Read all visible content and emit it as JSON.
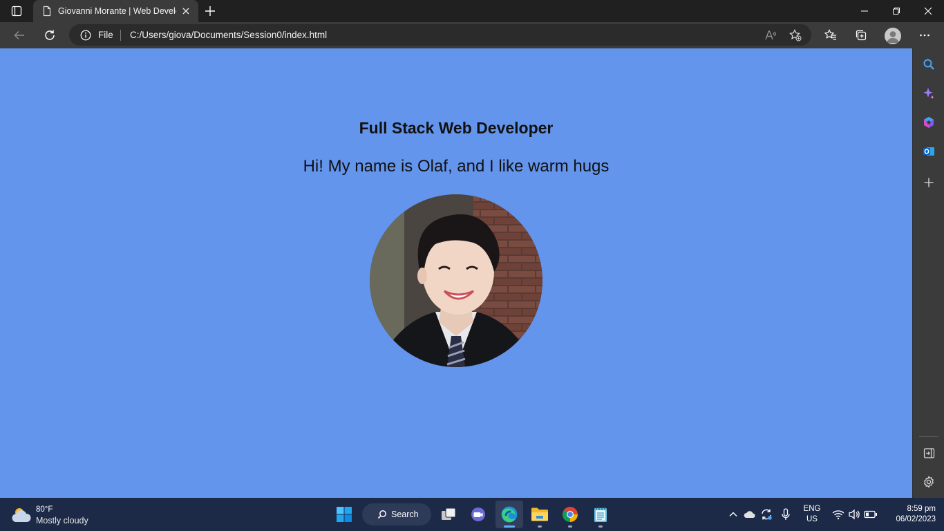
{
  "browser": {
    "tab": {
      "title": "Giovanni Morante | Web Developer"
    },
    "address": {
      "scheme_label": "File",
      "url": "C:/Users/giova/Documents/Session0/index.html"
    }
  },
  "page": {
    "heading": "Full Stack Web Developer",
    "intro": "Hi! My name is Olaf, and I like warm hugs",
    "background_color": "#6495ed"
  },
  "sidebar": {
    "items": [
      "search-icon",
      "copilot-icon",
      "office-icon",
      "outlook-icon",
      "add-icon"
    ],
    "bottom": [
      "sidebar-split-icon",
      "settings-icon"
    ]
  },
  "taskbar": {
    "weather": {
      "temp": "80°F",
      "condition": "Mostly cloudy"
    },
    "search_label": "Search",
    "apps": [
      "start",
      "task-view",
      "teams-chat",
      "edge",
      "file-explorer",
      "chrome",
      "notepad"
    ],
    "language": {
      "line1": "ENG",
      "line2": "US"
    },
    "clock": {
      "time": "8:59 pm",
      "date": "06/02/2023"
    }
  },
  "colors": {
    "accent": "#5fb2f2",
    "toolbar": "#3b3b3b",
    "taskbar": "#1c2a48"
  }
}
